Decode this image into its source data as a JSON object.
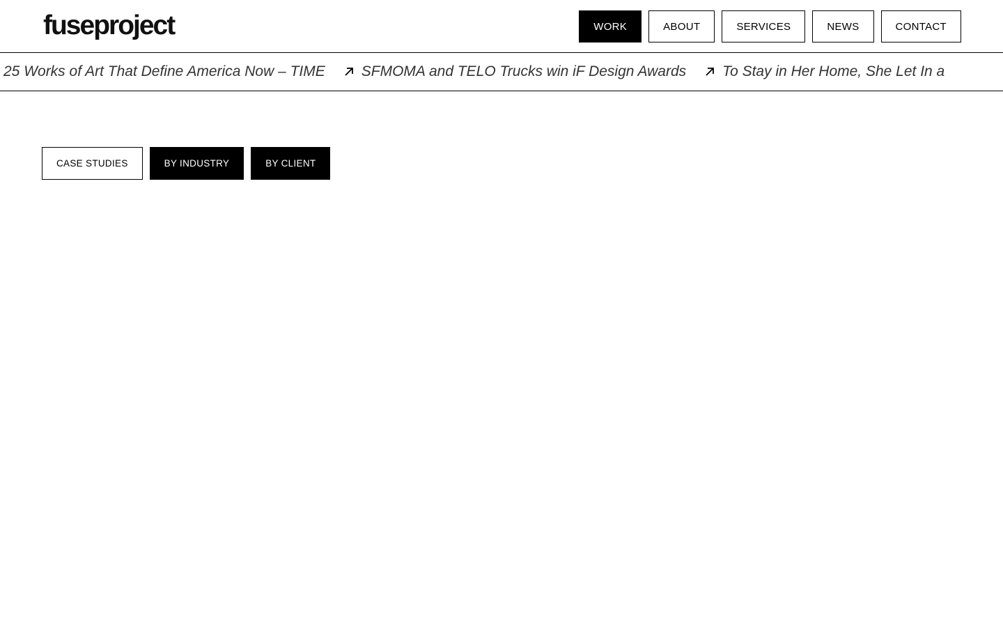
{
  "header": {
    "logo": "fuseproject",
    "nav": [
      {
        "label": "WORK",
        "active": true
      },
      {
        "label": "ABOUT",
        "active": false
      },
      {
        "label": "SERVICES",
        "active": false
      },
      {
        "label": "NEWS",
        "active": false
      },
      {
        "label": "CONTACT",
        "active": false
      }
    ]
  },
  "ticker": {
    "items": [
      {
        "text": "25 Works of Art That Define America Now – TIME",
        "arrow": false
      },
      {
        "text": "SFMOMA and TELO Trucks win iF Design Awards",
        "arrow": true,
        "icon": "arrow-up-right-icon"
      },
      {
        "text": "To Stay in Her Home, She Let In a",
        "arrow": true,
        "icon": "arrow-up-right-icon"
      }
    ]
  },
  "filters": [
    {
      "label": "CASE STUDIES",
      "dark": false
    },
    {
      "label": "BY INDUSTRY",
      "dark": true
    },
    {
      "label": "BY CLIENT",
      "dark": true
    }
  ],
  "colors": {
    "background": "#ffffff",
    "primary": "#000000",
    "ticker_text": "#333333"
  }
}
